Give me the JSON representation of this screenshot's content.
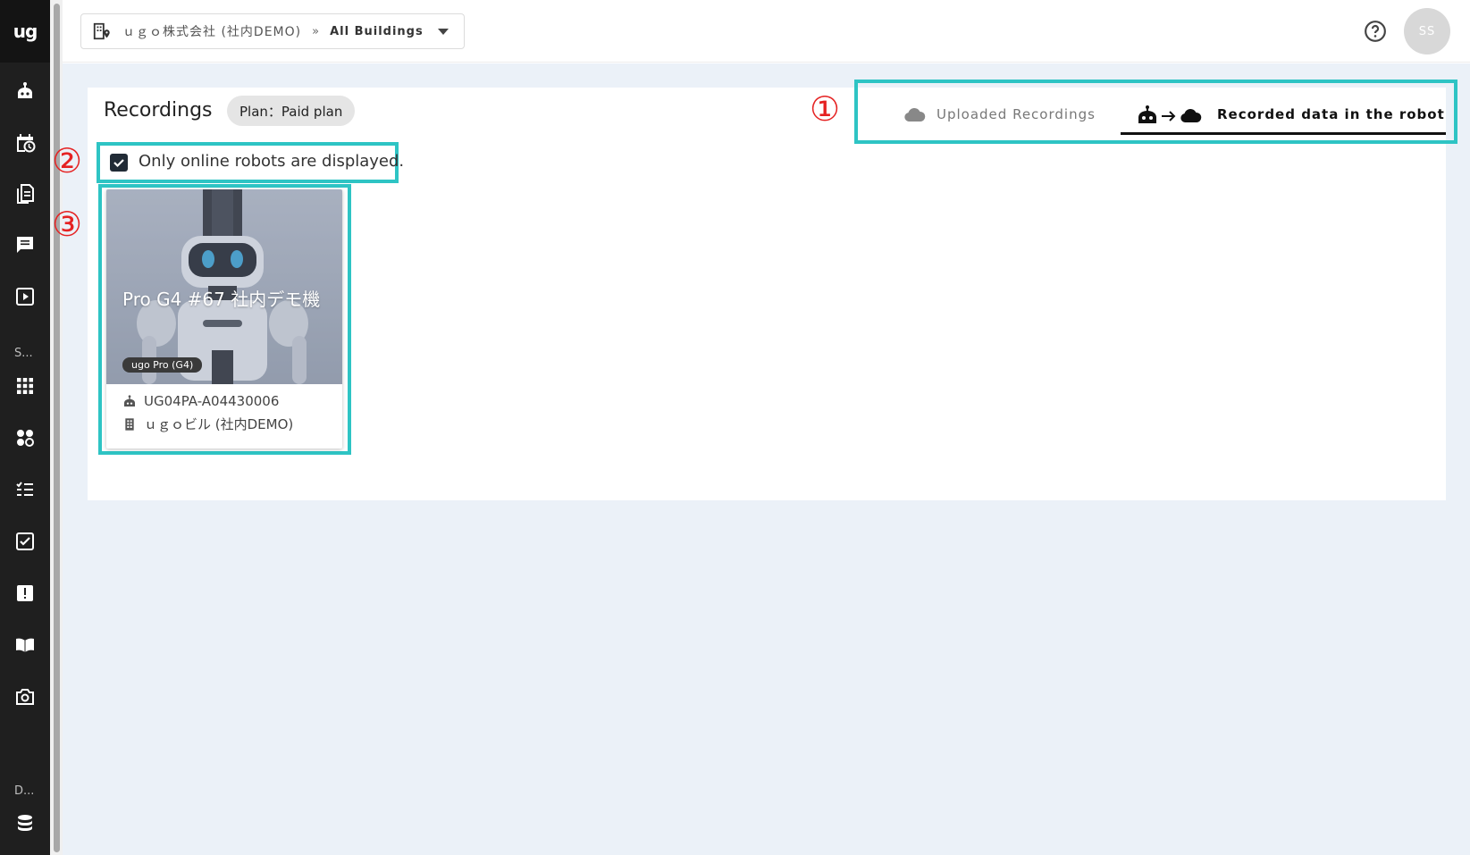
{
  "app": {
    "logo_text": "ug"
  },
  "sidebar": {
    "sections": [
      {
        "label": "S..."
      },
      {
        "label": "D..."
      }
    ],
    "icons": [
      "robot-icon",
      "calendar-clock-icon",
      "document-icon",
      "chat-icon",
      "play-icon",
      "grid-icon",
      "fan-icon",
      "checklist-icon",
      "task-check-icon",
      "alert-icon",
      "book-icon",
      "camera-icon",
      "database-icon"
    ]
  },
  "topbar": {
    "company": "ｕｇｏ株式会社 (社内DEMO)",
    "separator": "»",
    "building": "All Buildings",
    "avatar_initials": "SS"
  },
  "page": {
    "title": "Recordings",
    "plan_chip": "Plan：Paid plan"
  },
  "tabs": [
    {
      "label": "Uploaded Recordings",
      "active": false
    },
    {
      "label": "Recorded data in the robot",
      "active": true
    }
  ],
  "filter": {
    "checked": true,
    "label": "Only online robots are displayed."
  },
  "robot_card": {
    "name": "Pro G4 #67 社内デモ機",
    "model": "ugo Pro (G4)",
    "serial": "UG04PA-A04430006",
    "building": "ｕｇｏビル (社内DEMO)"
  },
  "callouts": [
    "①",
    "②",
    "③"
  ],
  "colors": {
    "sidebar_bg": "#1f1f1f",
    "highlight": "#2ec4c4",
    "callout": "#e52222",
    "main_bg": "#ebf1f8"
  }
}
